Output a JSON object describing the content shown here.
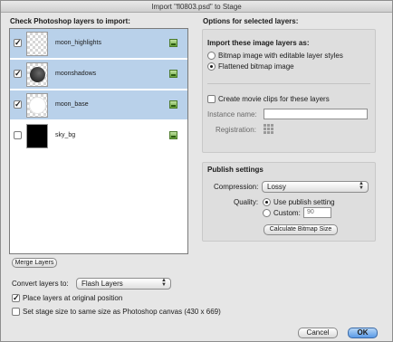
{
  "window": {
    "title": "Import \"fl0803.psd\" to Stage"
  },
  "left_panel": {
    "heading": "Check Photoshop layers to import:",
    "layers": [
      {
        "name": "moon_highlights",
        "checked": true,
        "selected": true
      },
      {
        "name": "moonshadows",
        "checked": true,
        "selected": true
      },
      {
        "name": "moon_base",
        "checked": true,
        "selected": true
      },
      {
        "name": "sky_bg",
        "checked": false,
        "selected": false
      }
    ],
    "merge_button": "Merge Layers"
  },
  "right_panel": {
    "heading": "Options for selected layers:",
    "import_as_label": "Import these image layers as:",
    "import_options": [
      {
        "label": "Bitmap image with editable layer styles",
        "selected": false
      },
      {
        "label": "Flattened bitmap image",
        "selected": true
      }
    ],
    "movie_clips_label": "Create movie clips for these layers",
    "instance_name_label": "Instance name:",
    "instance_name_value": "",
    "registration_label": "Registration:",
    "publish": {
      "heading": "Publish settings",
      "compression_label": "Compression:",
      "compression_value": "Lossy",
      "quality_label": "Quality:",
      "quality_options": [
        {
          "label": "Use publish setting",
          "selected": true
        },
        {
          "label": "Custom:",
          "selected": false
        }
      ],
      "custom_value": "90",
      "calc_button": "Calculate Bitmap Size"
    }
  },
  "bottom": {
    "convert_label": "Convert layers to:",
    "convert_value": "Flash Layers",
    "place_label": "Place layers at original position",
    "place_checked": true,
    "stage_size_label": "Set stage size to same size as Photoshop canvas (430 x 669)",
    "stage_size_checked": false
  },
  "buttons": {
    "cancel": "Cancel",
    "ok": "OK"
  },
  "icons": {
    "checkmark": "✓",
    "layer_type": "bitmap-image-icon",
    "registration": "registration-grid-icon",
    "dropdown": "stepper-arrows-icon"
  },
  "colors": {
    "selection": "#b9d1ea",
    "default_button": "#5a9ae6"
  }
}
